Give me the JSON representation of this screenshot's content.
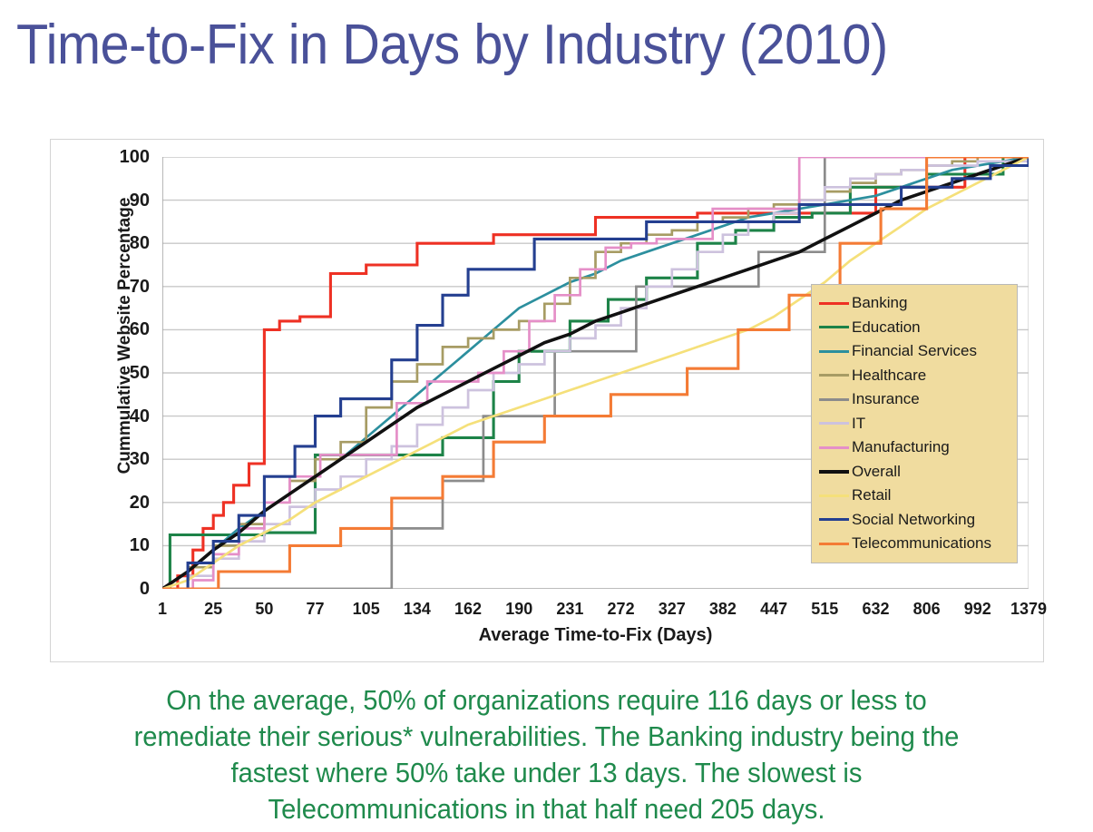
{
  "slide": {
    "title": "Time-to-Fix in Days by Industry (2010)",
    "title_color": "#4a5199",
    "caption_color": "#1f8a4c",
    "caption_lines": [
      "On the average, 50% of organizations require 116 days or less to",
      "remediate their serious* vulnerabilities. The Banking industry being the",
      "fastest where 50% take under 13 days. The slowest is",
      "Telecommunications in that half need 205 days."
    ]
  },
  "chart_data": {
    "type": "line",
    "title": "Time-to-Fix in Days by Industry (2010)",
    "subtitle": "",
    "xlabel": "Average Time-to-Fix (Days)",
    "ylabel": "Cummulative Website Percentage",
    "ylim": [
      0,
      100
    ],
    "ytick_labels": [
      "0",
      "10",
      "20",
      "30",
      "40",
      "50",
      "60",
      "70",
      "80",
      "90",
      "100"
    ],
    "ytick_values": [
      0,
      10,
      20,
      30,
      40,
      50,
      60,
      70,
      80,
      90,
      100
    ],
    "xtick_labels": [
      "1",
      "25",
      "50",
      "77",
      "105",
      "134",
      "162",
      "190",
      "231",
      "272",
      "327",
      "382",
      "447",
      "515",
      "632",
      "806",
      "992",
      "1379"
    ],
    "xtick_values": [
      1,
      25,
      50,
      77,
      105,
      134,
      162,
      190,
      231,
      272,
      327,
      382,
      447,
      515,
      632,
      806,
      992,
      1379
    ],
    "x_axis_type": "categorical-ordinal",
    "x_minor_ticks_between_labels": 1,
    "grid": "horizontal",
    "legend_position": "inside-bottom-right",
    "legend_background": "#f0dc9f",
    "annotations": [
      "Overall median 116 days",
      "Banking fastest: 50% under 13 days",
      "Telecommunications slowest: 50% need 205 days"
    ],
    "series": [
      {
        "name": "Banking",
        "color": "#ee3124",
        "step": true,
        "x_index": [
          0,
          0.6,
          1.2,
          1.6,
          2.0,
          2.4,
          2.8,
          3.4,
          4.0,
          4.6,
          5.4,
          6.6,
          8.0,
          10.0,
          13.0,
          17.0,
          21.0,
          24.0,
          25.6,
          27.0,
          28.0,
          30.2,
          31.5,
          34.0
        ],
        "values": [
          0,
          3,
          9,
          14,
          17,
          20,
          24,
          29,
          60,
          62,
          63,
          73,
          75,
          80,
          82,
          86,
          87,
          87,
          87,
          87,
          93,
          93,
          100,
          100
        ]
      },
      {
        "name": "Education",
        "color": "#1d8348",
        "step": true,
        "x_index": [
          0,
          0.3,
          2.0,
          4.0,
          6.0,
          7.0,
          9.0,
          11.0,
          13.0,
          14.0,
          16.0,
          17.5,
          19.0,
          21.0,
          22.5,
          24.0,
          25.5,
          27.0,
          28.5,
          30.0,
          31.5,
          33.0,
          34.0
        ],
        "values": [
          0,
          12.5,
          12.5,
          13,
          31,
          31,
          31,
          35,
          48,
          55,
          62,
          67,
          72,
          80,
          83,
          86,
          87,
          93,
          93,
          96,
          96,
          100,
          100
        ]
      },
      {
        "name": "Financial Services",
        "color": "#2c8f9e",
        "step": false,
        "x_index": [
          0,
          1,
          2,
          3,
          4,
          5,
          6,
          7,
          8,
          9,
          10,
          11,
          12,
          13,
          14,
          15,
          16,
          17,
          18,
          19,
          20,
          21,
          22,
          23,
          24,
          25,
          26,
          27,
          28,
          29,
          30,
          31,
          32,
          33,
          34
        ],
        "values": [
          0,
          4,
          9,
          14,
          18,
          22,
          26,
          30,
          35,
          40,
          45,
          50,
          55,
          60,
          65,
          68,
          71,
          73,
          76,
          78,
          80,
          82,
          84,
          86,
          87,
          88,
          89,
          90,
          91,
          93,
          95,
          97,
          98,
          99,
          100
        ]
      },
      {
        "name": "Healthcare",
        "color": "#a79c64",
        "step": true,
        "x_index": [
          0,
          1,
          2,
          3,
          4,
          5,
          6,
          7,
          8,
          9,
          10,
          11,
          12,
          13,
          14,
          15,
          16,
          17,
          18,
          19,
          20,
          21,
          22,
          23,
          24,
          25,
          26,
          27,
          28,
          29,
          30,
          31,
          32,
          34
        ],
        "values": [
          0,
          5,
          10,
          15,
          20,
          25,
          30,
          34,
          42,
          48,
          52,
          56,
          58,
          60,
          62,
          66,
          72,
          78,
          80,
          82,
          83,
          85,
          86,
          88,
          89,
          90,
          92,
          94,
          96,
          97,
          98,
          99,
          100,
          100
        ]
      },
      {
        "name": "Insurance",
        "color": "#8c8c8c",
        "step": true,
        "x_index": [
          0,
          9.0,
          9.0,
          11.0,
          11.0,
          12.6,
          12.6,
          15.4,
          15.4,
          18.6,
          18.6,
          21.0,
          21.0,
          23.4,
          23.4,
          26.0,
          26.0,
          34.0
        ],
        "values": [
          0,
          0,
          14,
          14,
          25,
          25,
          40,
          40,
          55,
          55,
          70,
          70,
          70,
          70,
          78,
          78,
          100,
          100
        ]
      },
      {
        "name": "IT",
        "color": "#cdc2de",
        "step": true,
        "x_index": [
          0,
          1,
          2,
          3,
          4,
          5,
          6,
          7,
          8,
          9,
          10,
          11,
          12,
          13,
          14,
          15,
          16,
          17,
          18,
          19,
          20,
          21,
          22,
          23,
          24,
          25,
          26,
          27,
          28,
          29,
          30,
          32,
          34
        ],
        "values": [
          0,
          3,
          7,
          11,
          15,
          19,
          23,
          26,
          30,
          33,
          38,
          42,
          46,
          50,
          52,
          55,
          58,
          61,
          65,
          70,
          74,
          78,
          82,
          85,
          87,
          90,
          93,
          95,
          96,
          97,
          98,
          99,
          100
        ]
      },
      {
        "name": "Manufacturing",
        "color": "#e58fc8",
        "step": true,
        "x_index": [
          0,
          1.2,
          2.0,
          3.0,
          4.0,
          5.0,
          6.2,
          7.4,
          8.4,
          9.2,
          10.4,
          11.4,
          12.4,
          13.4,
          14.4,
          15.4,
          16.4,
          17.4,
          18.4,
          19.4,
          20.6,
          21.6,
          23.0,
          25.0,
          34.0
        ],
        "values": [
          0,
          2,
          8,
          14,
          20,
          26,
          31,
          31,
          31,
          43,
          48,
          48,
          50,
          55,
          62,
          68,
          74,
          79,
          80,
          81,
          81,
          88,
          88,
          100,
          100
        ]
      },
      {
        "name": "Overall",
        "color": "#111111",
        "step": false,
        "x_index": [
          0,
          1,
          2,
          3,
          4,
          5,
          6,
          7,
          8,
          9,
          10,
          11,
          12,
          13,
          14,
          15,
          16,
          17,
          18,
          19,
          20,
          21,
          22,
          23,
          24,
          25,
          26,
          27,
          28,
          29,
          30,
          31,
          32,
          33,
          34
        ],
        "values": [
          0,
          4,
          9,
          13,
          18,
          22,
          26,
          30,
          34,
          38,
          42,
          45,
          48,
          51,
          54,
          57,
          59,
          62,
          64,
          66,
          68,
          70,
          72,
          74,
          76,
          78,
          81,
          84,
          87,
          90,
          92,
          94,
          96,
          98,
          100
        ]
      },
      {
        "name": "Retail",
        "color": "#f5e07a",
        "step": false,
        "x_index": [
          0,
          1,
          2,
          3,
          4,
          5,
          6,
          7,
          8,
          9,
          10,
          11,
          12,
          13,
          14,
          15,
          16,
          17,
          18,
          19,
          20,
          21,
          22,
          23,
          24,
          25,
          26,
          27,
          28,
          29,
          30,
          31,
          32,
          33,
          34
        ],
        "values": [
          0,
          2,
          6,
          10,
          13,
          16,
          20,
          23,
          26,
          29,
          32,
          35,
          38,
          40,
          42,
          44,
          46,
          48,
          50,
          52,
          54,
          56,
          58,
          60,
          63,
          67,
          71,
          76,
          80,
          84,
          88,
          91,
          94,
          97,
          100
        ]
      },
      {
        "name": "Social Networking",
        "color": "#243f90",
        "step": true,
        "x_index": [
          0,
          1.0,
          2.0,
          3.0,
          4.0,
          4.6,
          5.2,
          6.0,
          7.0,
          8.0,
          9.0,
          10.0,
          11.0,
          12.0,
          13.0,
          14.6,
          16.0,
          17.4,
          19.0,
          21.0,
          23.0,
          25.0,
          27.0,
          29.0,
          31.0,
          32.5,
          34.0
        ],
        "values": [
          0,
          6,
          11,
          17,
          26,
          26,
          33,
          40,
          44,
          44,
          53,
          61,
          68,
          74,
          74,
          81,
          81,
          81,
          85,
          85,
          85,
          89,
          89,
          93,
          95,
          98,
          100
        ]
      },
      {
        "name": "Telecommunications",
        "color": "#f47b35",
        "step": true,
        "x_index": [
          0,
          2.2,
          2.2,
          5.0,
          5.0,
          7.0,
          7.0,
          9.0,
          9.0,
          11.0,
          11.0,
          13.0,
          13.0,
          15.0,
          15.0,
          17.6,
          17.6,
          20.6,
          20.6,
          22.6,
          22.6,
          24.6,
          24.6,
          26.6,
          26.6,
          28.2,
          28.2,
          30.0,
          30.0,
          34.0
        ],
        "values": [
          0,
          0,
          4,
          4,
          10,
          10,
          14,
          14,
          21,
          21,
          26,
          26,
          34,
          34,
          40,
          40,
          45,
          45,
          51,
          51,
          60,
          60,
          68,
          68,
          80,
          80,
          88,
          88,
          100,
          100
        ]
      }
    ]
  },
  "legend": {
    "items": [
      {
        "label": "Banking",
        "color": "#ee3124",
        "width": 3.5
      },
      {
        "label": "Education",
        "color": "#1d8348",
        "width": 3.5
      },
      {
        "label": "Financial Services",
        "color": "#2c8f9e",
        "width": 3
      },
      {
        "label": "Healthcare",
        "color": "#a79c64",
        "width": 3
      },
      {
        "label": "Insurance",
        "color": "#8c8c8c",
        "width": 3
      },
      {
        "label": "IT",
        "color": "#cdc2de",
        "width": 3
      },
      {
        "label": "Manufacturing",
        "color": "#e58fc8",
        "width": 3
      },
      {
        "label": "Overall",
        "color": "#111111",
        "width": 4
      },
      {
        "label": "Retail",
        "color": "#f5e07a",
        "width": 3
      },
      {
        "label": "Social Networking",
        "color": "#243f90",
        "width": 3.5
      },
      {
        "label": "Telecommunications",
        "color": "#f47b35",
        "width": 3.5
      }
    ]
  }
}
